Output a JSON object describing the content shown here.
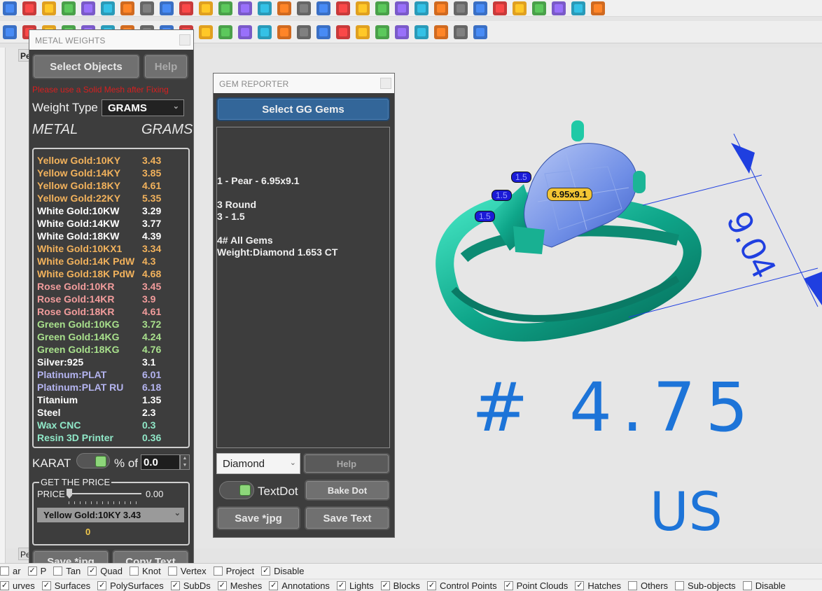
{
  "metal_panel": {
    "title": "METAL WEIGHTS",
    "select_objects_label": "Select Objects",
    "help_label": "Help",
    "warning": "Please use a Solid Mesh after Fixing",
    "weight_type_label": "Weight Type",
    "weight_type_value": "GRAMS",
    "col_metal": "METAL",
    "col_grams": "GRAMS",
    "metals": [
      {
        "name": "Yellow Gold:10KY",
        "value": "3.43",
        "color": "#f2b25c"
      },
      {
        "name": "Yellow Gold:14KY",
        "value": "3.85",
        "color": "#f2b25c"
      },
      {
        "name": "Yellow Gold:18KY",
        "value": "4.61",
        "color": "#f2b25c"
      },
      {
        "name": "Yellow Gold:22KY",
        "value": "5.35",
        "color": "#f2b25c"
      },
      {
        "name": "White Gold:10KW",
        "value": "3.29",
        "color": "#ffffff"
      },
      {
        "name": "White Gold:14KW",
        "value": "3.77",
        "color": "#ffffff"
      },
      {
        "name": "White Gold:18KW",
        "value": "4.39",
        "color": "#ffffff"
      },
      {
        "name": "White Gold:10KX1",
        "value": "3.34",
        "color": "#f2b25c"
      },
      {
        "name": "White Gold:14K PdW",
        "value": "4.3",
        "color": "#f2b25c"
      },
      {
        "name": "White Gold:18K PdW",
        "value": "4.68",
        "color": "#f2b25c"
      },
      {
        "name": "Rose Gold:10KR",
        "value": "3.45",
        "color": "#f29c9c"
      },
      {
        "name": "Rose Gold:14KR",
        "value": "3.9",
        "color": "#f29c9c"
      },
      {
        "name": "Rose Gold:18KR",
        "value": "4.61",
        "color": "#f29c9c"
      },
      {
        "name": "Green Gold:10KG",
        "value": "3.72",
        "color": "#a8e08c"
      },
      {
        "name": "Green Gold:14KG",
        "value": "4.24",
        "color": "#a8e08c"
      },
      {
        "name": "Green Gold:18KG",
        "value": "4.76",
        "color": "#a8e08c"
      },
      {
        "name": "Silver:925",
        "value": "3.1",
        "color": "#ffffff"
      },
      {
        "name": "Platinum:PLAT",
        "value": "6.01",
        "color": "#b4b4f0"
      },
      {
        "name": "Platinum:PLAT RU",
        "value": "6.18",
        "color": "#b4b4f0"
      },
      {
        "name": "Titanium",
        "value": "1.35",
        "color": "#ffffff"
      },
      {
        "name": "Steel",
        "value": "2.3",
        "color": "#ffffff"
      },
      {
        "name": "Wax  CNC",
        "value": "0.3",
        "color": "#90e8c8"
      },
      {
        "name": "Resin 3D Printer",
        "value": "0.36",
        "color": "#90e8c8"
      }
    ],
    "karat_label": "KARAT",
    "percent_of_label": "% of",
    "percent_value": "0.0",
    "get_price_title": "GET THE PRICE",
    "price_label": "PRICE",
    "price_value": "0.00",
    "price_select_value": "Yellow Gold:10KY 3.43",
    "price_total": "0",
    "save_jpg_label": "Save *jpg",
    "copy_text_label": "Copy Text"
  },
  "gem_panel": {
    "title": "GEM REPORTER",
    "select_gems_label": "Select GG Gems",
    "report_lines": [
      "1 - Pear - 6.95x9.1",
      "",
      "3 Round",
      "3 - 1.5",
      "",
      "4# All Gems",
      "Weight:Diamond 1.653 CT"
    ],
    "gem_type_value": "Diamond",
    "help_label": "Help",
    "textdot_label": "TextDot",
    "bake_dot_label": "Bake Dot",
    "save_jpg_label": "Save *jpg",
    "save_text_label": "Save Text"
  },
  "viewport": {
    "tab_label": "Pe",
    "bottom_tab_label": "Pe",
    "pear_dot": "6.95x9.1",
    "round_dots": [
      "1.5",
      "1.5",
      "1.5"
    ],
    "dimension": "9.04",
    "handwriting_size": "# 4.75",
    "handwriting_us": "US"
  },
  "osnap_bar": {
    "items": [
      {
        "label": "ar",
        "checked": false
      },
      {
        "label": "P",
        "checked": true
      },
      {
        "label": "Tan",
        "checked": false
      },
      {
        "label": "Quad",
        "checked": true
      },
      {
        "label": "Knot",
        "checked": false
      },
      {
        "label": "Vertex",
        "checked": false
      },
      {
        "label": "Project",
        "checked": false
      },
      {
        "label": "Disable",
        "checked": true
      }
    ]
  },
  "filter_bar": {
    "items": [
      {
        "label": "urves",
        "checked": true
      },
      {
        "label": "Surfaces",
        "checked": true
      },
      {
        "label": "PolySurfaces",
        "checked": true
      },
      {
        "label": "SubDs",
        "checked": true
      },
      {
        "label": "Meshes",
        "checked": true
      },
      {
        "label": "Annotations",
        "checked": true
      },
      {
        "label": "Lights",
        "checked": true
      },
      {
        "label": "Blocks",
        "checked": true
      },
      {
        "label": "Control Points",
        "checked": true
      },
      {
        "label": "Point Clouds",
        "checked": true
      },
      {
        "label": "Hatches",
        "checked": true
      },
      {
        "label": "Others",
        "checked": false
      },
      {
        "label": "Sub-objects",
        "checked": false
      },
      {
        "label": "Disable",
        "checked": false
      }
    ]
  },
  "toolbar_icons_row1": [
    "box-icon",
    "page-icon",
    "scissors-icon",
    "copy-icon",
    "clipboard-icon",
    "undo-icon",
    "hand-icon",
    "rotate-icon",
    "zoom-icon",
    "zoom-window-icon",
    "zoom-extents-icon",
    "zoom-selected-icon",
    "zoom-dynamic-icon",
    "grid-icon",
    "car-icon",
    "plane-icon",
    "target-icon",
    "camera-icon",
    "bulb-icon",
    "lock-icon",
    "layers-icon",
    "color-wheel-icon",
    "sphere-wire-icon",
    "sphere-mesh-icon",
    "sphere-render-icon",
    "cursor-icon",
    "gear-icon",
    "network-icon",
    "globe-icon",
    "help-icon",
    "exit-icon"
  ],
  "toolbar_icons_row2": [
    "cube-icon",
    "curve-icon",
    "star-icon",
    "shape-icon",
    "gem-icon",
    "brush-icon",
    "puzzle-icon",
    "mesh-icon",
    "wrench-icon",
    "link-icon",
    "chain-icon",
    "flow-icon",
    "cube-gold-icon",
    "pen-icon",
    "globe-blue-icon",
    "pencil-icon",
    "quill-icon",
    "list-icon",
    "box-gold-icon",
    "sphere-icon",
    "half-sphere-icon",
    "rotate-sphere-icon",
    "no-icon",
    "funnel-icon",
    "bug-icon"
  ]
}
